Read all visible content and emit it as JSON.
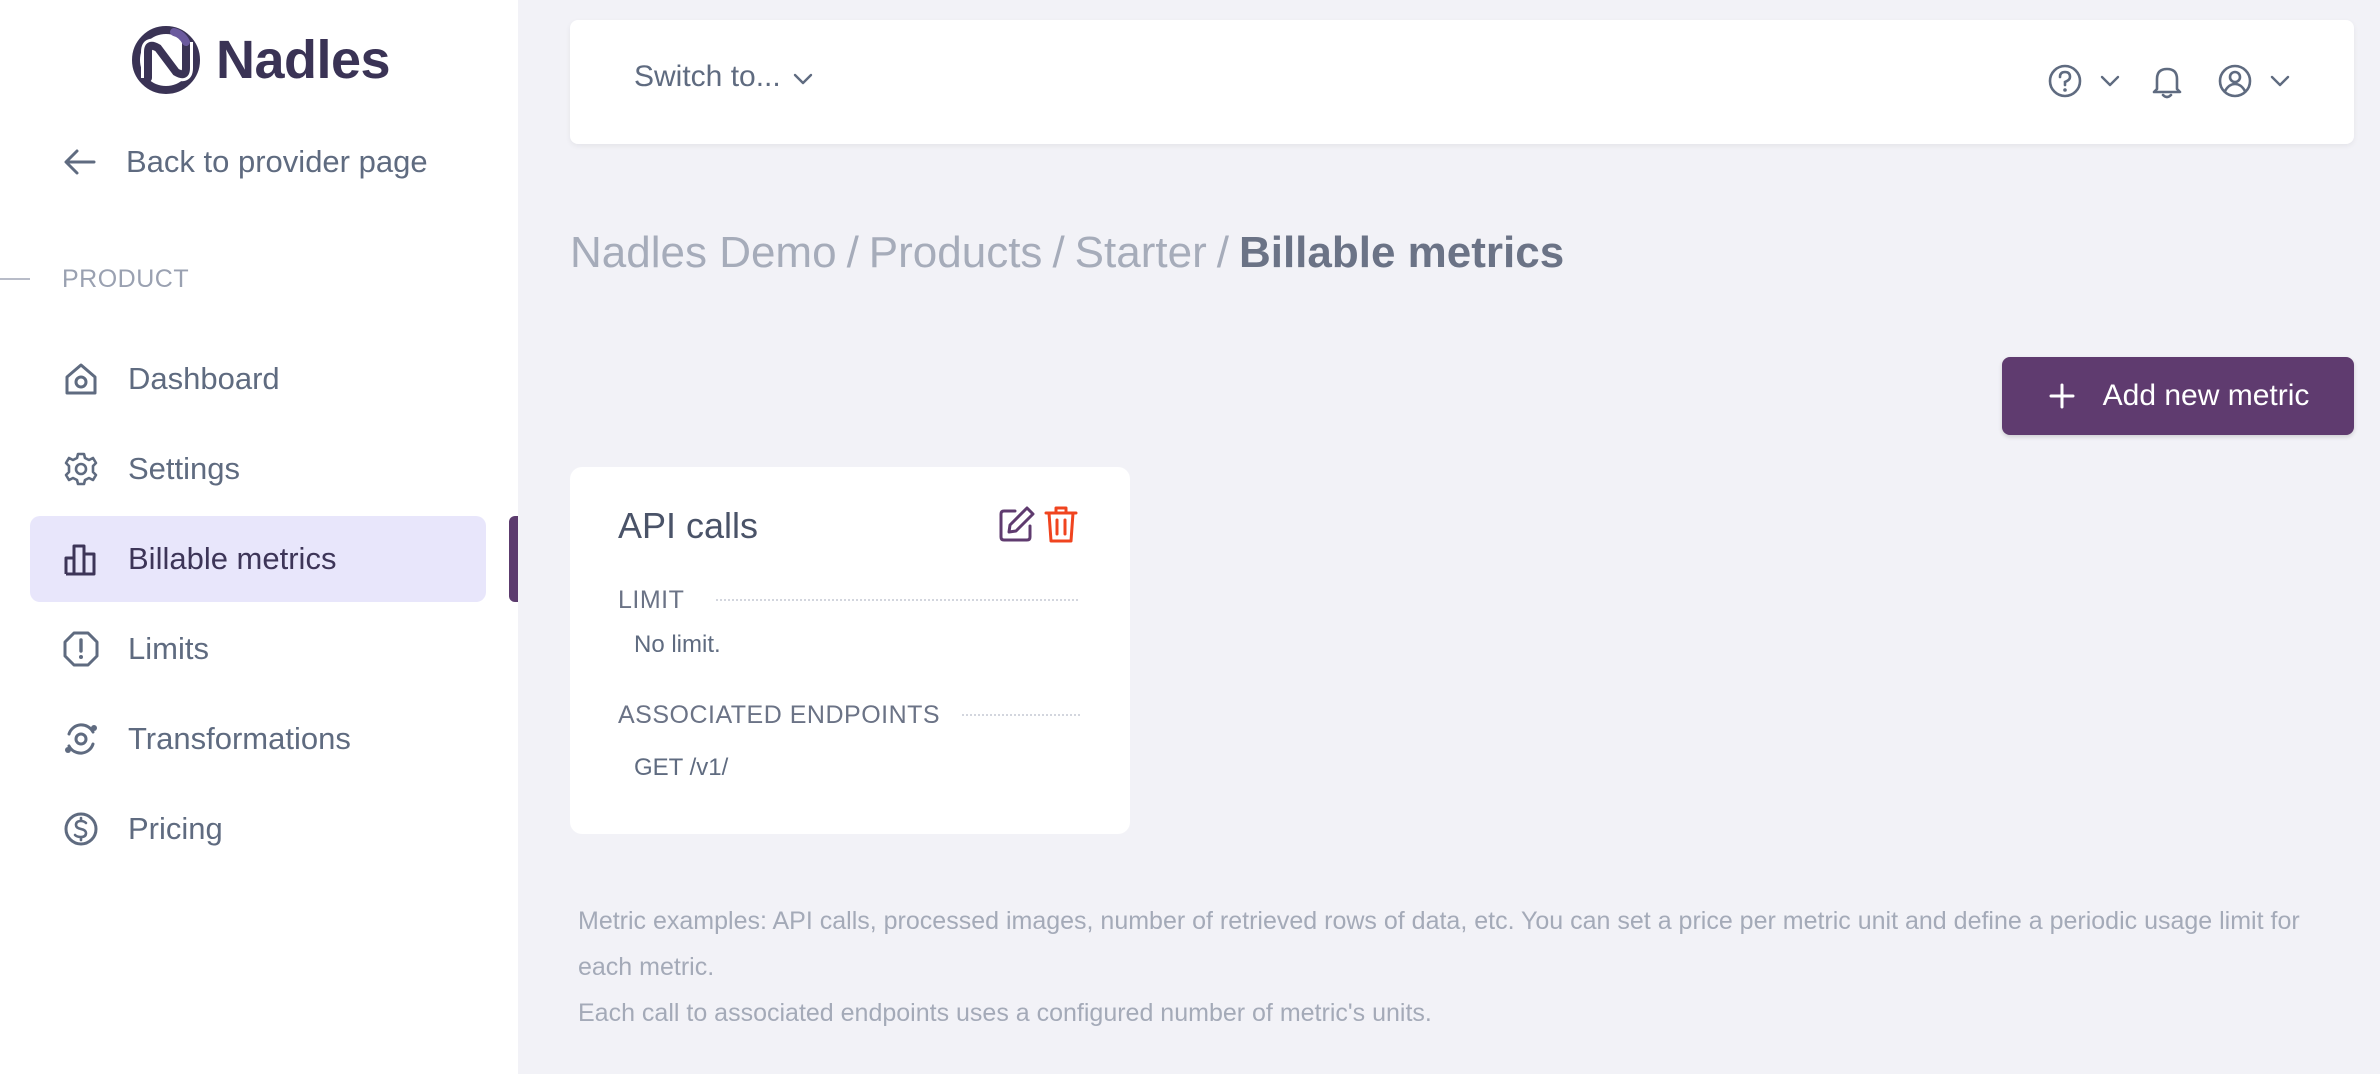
{
  "brand": {
    "name": "Nadles"
  },
  "sidebar": {
    "back_label": "Back to provider page",
    "section_label": "PRODUCT",
    "items": [
      {
        "label": "Dashboard",
        "icon": "home-icon",
        "active": false
      },
      {
        "label": "Settings",
        "icon": "gear-icon",
        "active": false
      },
      {
        "label": "Billable metrics",
        "icon": "bar-chart-icon",
        "active": true
      },
      {
        "label": "Limits",
        "icon": "alert-shield-icon",
        "active": false
      },
      {
        "label": "Transformations",
        "icon": "transform-icon",
        "active": false
      },
      {
        "label": "Pricing",
        "icon": "dollar-circle-icon",
        "active": false
      }
    ]
  },
  "topbar": {
    "switcher_label": "Switch to...",
    "icons": [
      "help-icon",
      "bell-icon",
      "user-icon"
    ]
  },
  "breadcrumb": {
    "items": [
      "Nadles Demo",
      "Products",
      "Starter"
    ],
    "current": "Billable metrics",
    "separator": "/"
  },
  "actions": {
    "add_metric_label": "Add new metric"
  },
  "metric": {
    "name": "API calls",
    "limit_label": "LIMIT",
    "limit_value": "No limit.",
    "endpoints_label": "ASSOCIATED ENDPOINTS",
    "endpoints": [
      "GET /v1/"
    ]
  },
  "help_text": {
    "line1": "Metric examples: API calls, processed images, number of retrieved rows of data, etc. You can set a price per metric unit and define a periodic usage limit for each metric.",
    "line2": "Each call to associated endpoints uses a configured number of metric's units."
  },
  "colors": {
    "accent": "#5f3b6f",
    "active_bg": "#e8e6fb",
    "delete": "#f0441f",
    "page_bg": "#f2f2f7"
  }
}
